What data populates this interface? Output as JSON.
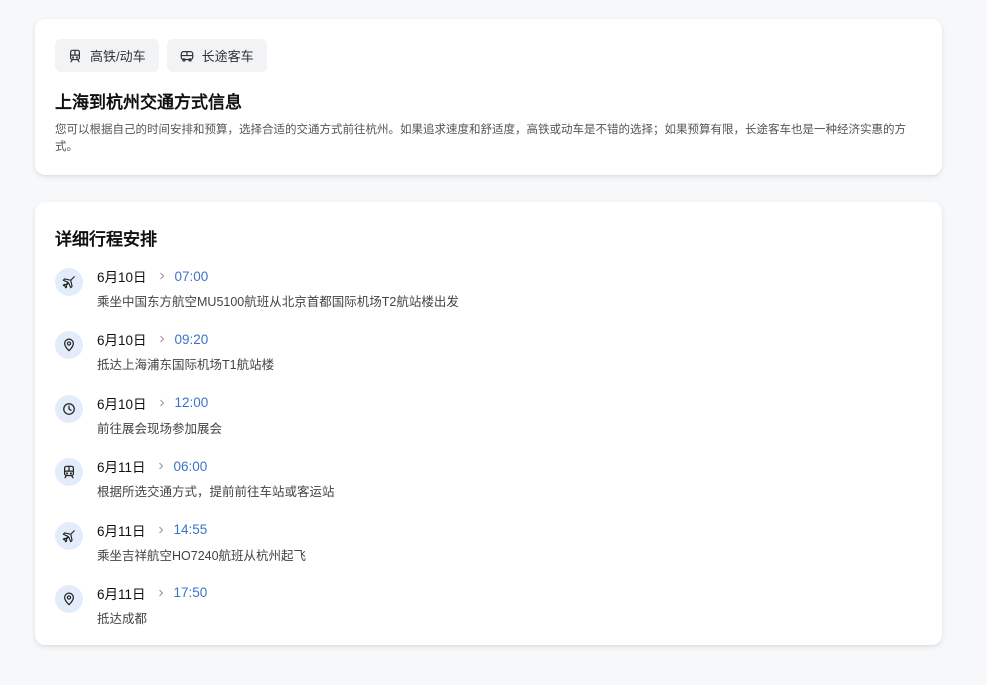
{
  "transport": {
    "tabs": [
      {
        "label": "高铁/动车",
        "icon": "train-icon"
      },
      {
        "label": "长途客车",
        "icon": "bus-icon"
      }
    ],
    "title": "上海到杭州交通方式信息",
    "description": "您可以根据自己的时间安排和预算，选择合适的交通方式前往杭州。如果追求速度和舒适度，高铁或动车是不错的选择；如果预算有限，长途客车也是一种经济实惠的方式。"
  },
  "itinerary": {
    "title": "详细行程安排",
    "events": [
      {
        "date": "6月10日",
        "time": "07:00",
        "text": "乘坐中国东方航空MU5100航班从北京首都国际机场T2航站楼出发",
        "icon": "plane-icon"
      },
      {
        "date": "6月10日",
        "time": "09:20",
        "text": "抵达上海浦东国际机场T1航站楼",
        "icon": "location-pin-icon"
      },
      {
        "date": "6月10日",
        "time": "12:00",
        "text": "前往展会现场参加展会",
        "icon": "clock-icon"
      },
      {
        "date": "6月11日",
        "time": "06:00",
        "text": "根据所选交通方式，提前前往车站或客运站",
        "icon": "train-icon"
      },
      {
        "date": "6月11日",
        "time": "14:55",
        "text": "乘坐吉祥航空HO7240航班从杭州起飞",
        "icon": "plane-icon"
      },
      {
        "date": "6月11日",
        "time": "17:50",
        "text": "抵达成都",
        "icon": "location-pin-icon"
      }
    ]
  },
  "colors": {
    "accent": "#3b73c8",
    "icon_bg": "#e2ecfb",
    "page_bg": "#f7f8fa"
  }
}
